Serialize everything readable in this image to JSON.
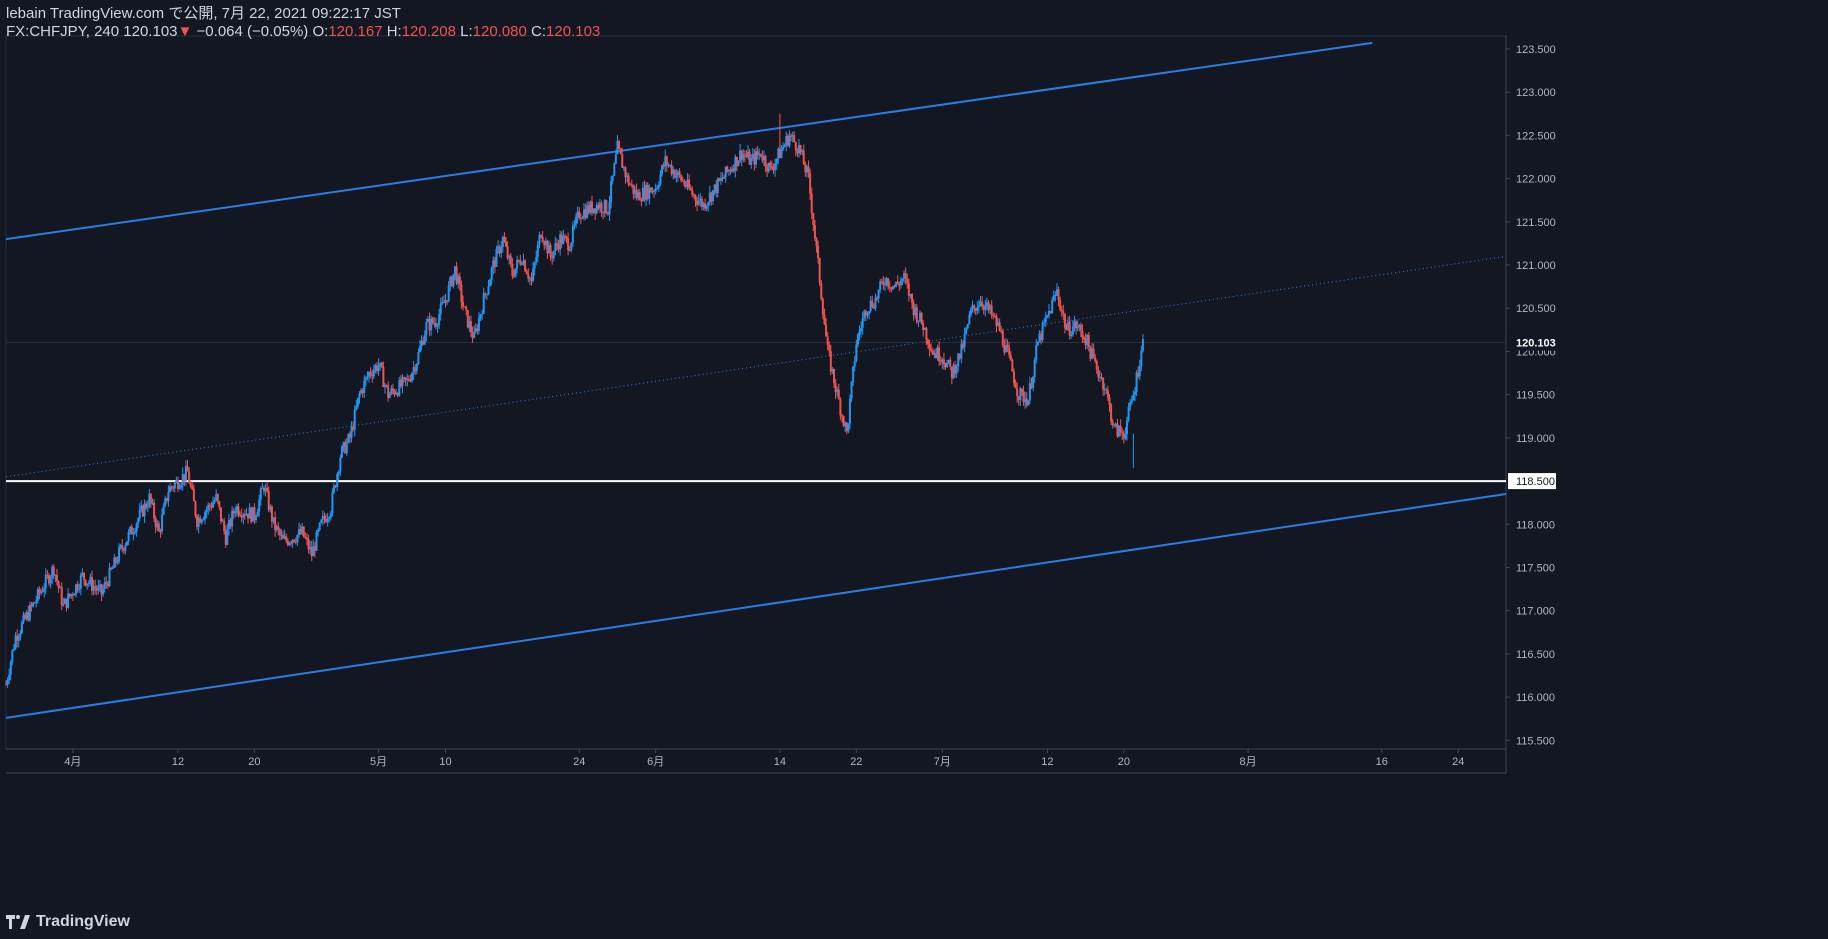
{
  "header": {
    "publish_line": "lebain TradingView.com で公開, 7月 22, 2021 09:22:17 JST",
    "symbol": "FX:CHFJPY, 240",
    "last": "120.103",
    "change_arrow": "▼",
    "change": "−0.064 (−0.05%)",
    "o_label": "O:",
    "o_value": "120.167",
    "h_label": "H:",
    "h_value": "120.208",
    "l_label": "L:",
    "l_value": "120.080",
    "c_label": "C:",
    "c_value": "120.103"
  },
  "brand": {
    "name": "TradingView",
    "icon": "tradingview-logo-icon"
  },
  "colors": {
    "background": "#131722",
    "up": "#2196f3",
    "down": "#ef5350",
    "channel": "#2a7de1",
    "level": "#ffffff"
  },
  "chart_data": {
    "type": "candlestick",
    "symbol": "FX:CHFJPY",
    "interval": "240",
    "ylim": [
      115.4,
      123.65
    ],
    "y_ticks": [
      "123.500",
      "123.000",
      "122.500",
      "122.000",
      "121.500",
      "121.000",
      "120.500",
      "120.000",
      "119.500",
      "119.000",
      "118.500",
      "118.000",
      "117.500",
      "117.000",
      "116.500",
      "116.000",
      "115.500"
    ],
    "x_range": [
      "2021-03-25",
      "2021-08-29"
    ],
    "x_ticks": [
      {
        "date": "2021-04-01",
        "label": "4月"
      },
      {
        "date": "2021-04-12",
        "label": "12"
      },
      {
        "date": "2021-04-20",
        "label": "20"
      },
      {
        "date": "2021-05-03",
        "label": "5月"
      },
      {
        "date": "2021-05-10",
        "label": "10"
      },
      {
        "date": "2021-05-24",
        "label": "24"
      },
      {
        "date": "2021-06-01",
        "label": "6月"
      },
      {
        "date": "2021-06-14",
        "label": "14"
      },
      {
        "date": "2021-06-22",
        "label": "22"
      },
      {
        "date": "2021-07-01",
        "label": "7月"
      },
      {
        "date": "2021-07-12",
        "label": "12"
      },
      {
        "date": "2021-07-20",
        "label": "20"
      },
      {
        "date": "2021-08-02",
        "label": "8月"
      },
      {
        "date": "2021-08-16",
        "label": "16"
      },
      {
        "date": "2021-08-24",
        "label": "24"
      }
    ],
    "price_path": [
      [
        "2021-03-25",
        116.15
      ],
      [
        "2021-03-26",
        116.7
      ],
      [
        "2021-03-28",
        117.1
      ],
      [
        "2021-03-30",
        117.5
      ],
      [
        "2021-03-31",
        117.05
      ],
      [
        "2021-04-02",
        117.4
      ],
      [
        "2021-04-04",
        117.2
      ],
      [
        "2021-04-06",
        117.7
      ],
      [
        "2021-04-08",
        118.1
      ],
      [
        "2021-04-09",
        118.3
      ],
      [
        "2021-04-10",
        117.9
      ],
      [
        "2021-04-11",
        118.4
      ],
      [
        "2021-04-13",
        118.6
      ],
      [
        "2021-04-14",
        118.05
      ],
      [
        "2021-04-16",
        118.3
      ],
      [
        "2021-04-17",
        117.85
      ],
      [
        "2021-04-18",
        118.2
      ],
      [
        "2021-04-20",
        118.1
      ],
      [
        "2021-04-21",
        118.45
      ],
      [
        "2021-04-22",
        118.0
      ],
      [
        "2021-04-23",
        117.8
      ],
      [
        "2021-04-25",
        117.9
      ],
      [
        "2021-04-26",
        117.65
      ],
      [
        "2021-04-27",
        118.0
      ],
      [
        "2021-04-28",
        118.2
      ],
      [
        "2021-04-29",
        118.8
      ],
      [
        "2021-04-30",
        119.0
      ],
      [
        "2021-05-01",
        119.5
      ],
      [
        "2021-05-02",
        119.75
      ],
      [
        "2021-05-03",
        119.85
      ],
      [
        "2021-05-04",
        119.5
      ],
      [
        "2021-05-06",
        119.65
      ],
      [
        "2021-05-07",
        119.9
      ],
      [
        "2021-05-08",
        120.3
      ],
      [
        "2021-05-09",
        120.35
      ],
      [
        "2021-05-10",
        120.6
      ],
      [
        "2021-05-11",
        120.95
      ],
      [
        "2021-05-12",
        120.45
      ],
      [
        "2021-05-13",
        120.15
      ],
      [
        "2021-05-14",
        120.6
      ],
      [
        "2021-05-15",
        121.0
      ],
      [
        "2021-05-16",
        121.3
      ],
      [
        "2021-05-17",
        120.9
      ],
      [
        "2021-05-18",
        121.1
      ],
      [
        "2021-05-19",
        120.8
      ],
      [
        "2021-05-20",
        121.4
      ],
      [
        "2021-05-21",
        121.1
      ],
      [
        "2021-05-22",
        121.3
      ],
      [
        "2021-05-23",
        121.25
      ],
      [
        "2021-05-24",
        121.6
      ],
      [
        "2021-05-26",
        121.7
      ],
      [
        "2021-05-27",
        121.65
      ],
      [
        "2021-05-28",
        122.35
      ],
      [
        "2021-05-29",
        122.0
      ],
      [
        "2021-05-30",
        121.8
      ],
      [
        "2021-06-01",
        121.9
      ],
      [
        "2021-06-02",
        122.2
      ],
      [
        "2021-06-04",
        121.95
      ],
      [
        "2021-06-05",
        121.8
      ],
      [
        "2021-06-06",
        121.7
      ],
      [
        "2021-06-08",
        122.0
      ],
      [
        "2021-06-10",
        122.3
      ],
      [
        "2021-06-11",
        122.2
      ],
      [
        "2021-06-12",
        122.3
      ],
      [
        "2021-06-13",
        122.1
      ],
      [
        "2021-06-14",
        122.3
      ],
      [
        "2021-06-15",
        122.5
      ],
      [
        "2021-06-16",
        122.35
      ],
      [
        "2021-06-17",
        122.0
      ],
      [
        "2021-06-18",
        121.0
      ],
      [
        "2021-06-19",
        120.0
      ],
      [
        "2021-06-20",
        119.5
      ],
      [
        "2021-06-21",
        119.05
      ],
      [
        "2021-06-22",
        120.1
      ],
      [
        "2021-06-23",
        120.5
      ],
      [
        "2021-06-24",
        120.6
      ],
      [
        "2021-06-25",
        120.85
      ],
      [
        "2021-06-26",
        120.75
      ],
      [
        "2021-06-27",
        120.85
      ],
      [
        "2021-06-28",
        120.5
      ],
      [
        "2021-06-29",
        120.3
      ],
      [
        "2021-06-30",
        120.0
      ],
      [
        "2021-07-01",
        119.95
      ],
      [
        "2021-07-02",
        119.75
      ],
      [
        "2021-07-03",
        120.0
      ],
      [
        "2021-07-04",
        120.45
      ],
      [
        "2021-07-05",
        120.6
      ],
      [
        "2021-07-06",
        120.45
      ],
      [
        "2021-07-07",
        120.25
      ],
      [
        "2021-07-08",
        119.9
      ],
      [
        "2021-07-09",
        119.5
      ],
      [
        "2021-07-10",
        119.45
      ],
      [
        "2021-07-11",
        120.1
      ],
      [
        "2021-07-12",
        120.4
      ],
      [
        "2021-07-13",
        120.7
      ],
      [
        "2021-07-14",
        120.25
      ],
      [
        "2021-07-15",
        120.3
      ],
      [
        "2021-07-16",
        120.15
      ],
      [
        "2021-07-17",
        119.85
      ],
      [
        "2021-07-18",
        119.6
      ],
      [
        "2021-07-19",
        119.1
      ],
      [
        "2021-07-20",
        119.05
      ],
      [
        "2021-07-21",
        119.5
      ],
      [
        "2021-07-22",
        120.1
      ]
    ],
    "highlights": [
      {
        "date": "2021-06-14",
        "high": 122.75
      },
      {
        "date": "2021-07-21",
        "low": 118.65
      }
    ],
    "lines": [
      {
        "name": "channel-upper",
        "style": "solid",
        "p1": [
          "2021-03-25",
          121.3
        ],
        "p2": [
          "2021-08-15",
          123.57
        ]
      },
      {
        "name": "channel-mid",
        "style": "dotted",
        "p1": [
          "2021-03-25",
          118.55
        ],
        "p2": [
          "2021-08-29",
          121.1
        ]
      },
      {
        "name": "channel-lower",
        "style": "solid",
        "p1": [
          "2021-03-25",
          115.76
        ],
        "p2": [
          "2021-08-29",
          118.35
        ]
      },
      {
        "name": "support-level",
        "style": "horizontal",
        "value": 118.5
      }
    ],
    "last_price_label": "120.103",
    "level_label": "118.500"
  }
}
